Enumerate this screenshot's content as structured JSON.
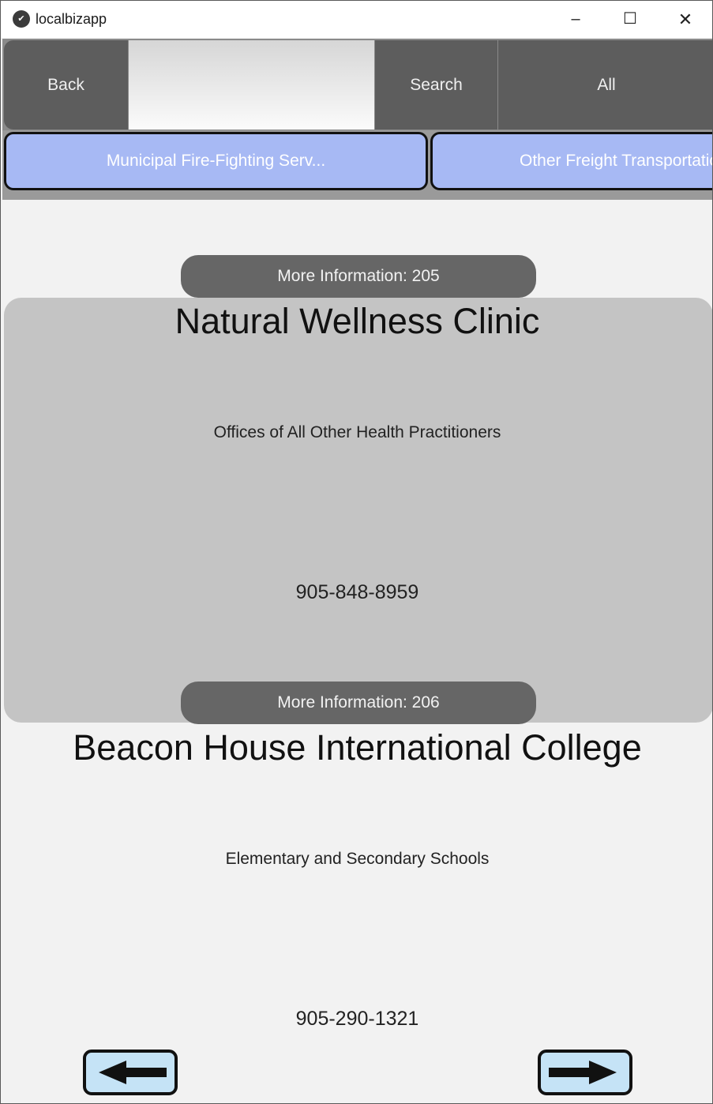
{
  "window": {
    "title": "localbizapp",
    "controls": {
      "minimize": "–",
      "maximize": "☐",
      "close": "✕"
    }
  },
  "toolbar": {
    "back_label": "Back",
    "search_value": "",
    "search_label": "Search",
    "all_label": "All"
  },
  "categories": [
    "Municipal Fire-Fighting Serv...",
    "Other Freight Transportation"
  ],
  "listings": [
    {
      "more_info": "More Information: 205",
      "name": "Natural Wellness Clinic",
      "category": "Offices of All Other Health Practitioners",
      "phone": "905-848-8959"
    },
    {
      "more_info": "More Information: 206",
      "name": "Beacon House International College",
      "category": "Elementary and Secondary Schools",
      "phone": "905-290-1321"
    }
  ],
  "colors": {
    "category_button": "#a7b9f4",
    "arrow_fill": "#c5e3f6",
    "card_bg": "#c4c4c4",
    "button_dark": "#5d5d5d"
  },
  "icons": {
    "prev": "left-arrow-icon",
    "next": "right-arrow-icon"
  }
}
